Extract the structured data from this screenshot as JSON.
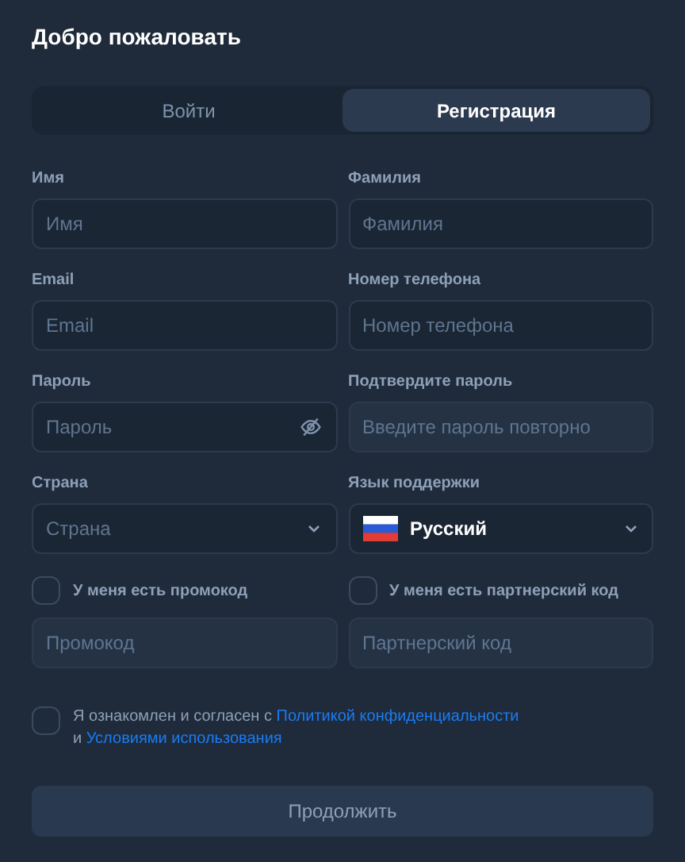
{
  "title": "Добро пожаловать",
  "tabs": [
    {
      "label": "Войти",
      "selected": false
    },
    {
      "label": "Регистрация",
      "selected": true
    }
  ],
  "fields": [
    {
      "label": "Имя",
      "placeholder": "Имя",
      "kind": "text",
      "disabled": false
    },
    {
      "label": "Фамилия",
      "placeholder": "Фамилия",
      "kind": "text",
      "disabled": false
    },
    {
      "label": "Email",
      "placeholder": "Email",
      "kind": "text",
      "disabled": false
    },
    {
      "label": "Номер телефона",
      "placeholder": "Номер телефона",
      "kind": "text",
      "disabled": false
    },
    {
      "label": "Пароль",
      "placeholder": "Пароль",
      "kind": "password",
      "disabled": false
    },
    {
      "label": "Подтвердите пароль",
      "placeholder": "Введите пароль повторно",
      "kind": "text",
      "disabled": true
    },
    {
      "label": "Страна",
      "placeholder": "Страна",
      "kind": "select",
      "disabled": false
    },
    {
      "label": "Язык поддержки",
      "value": "Русский",
      "kind": "language",
      "disabled": false
    }
  ],
  "codes": [
    {
      "label": "У меня есть промокод",
      "checked": false,
      "placeholder": "Промокод",
      "disabled": true
    },
    {
      "label": "У меня есть партнерский код",
      "checked": false,
      "placeholder": "Партнерский код",
      "disabled": true
    }
  ],
  "agreement": {
    "checked": false,
    "text": "Я ознакомлен и согласен с",
    "link": "Политикой конфиденциальности",
    "text_2": "и",
    "link_2": "Условиями использования"
  },
  "submit": {
    "label": "Продолжить",
    "disabled": true
  }
}
